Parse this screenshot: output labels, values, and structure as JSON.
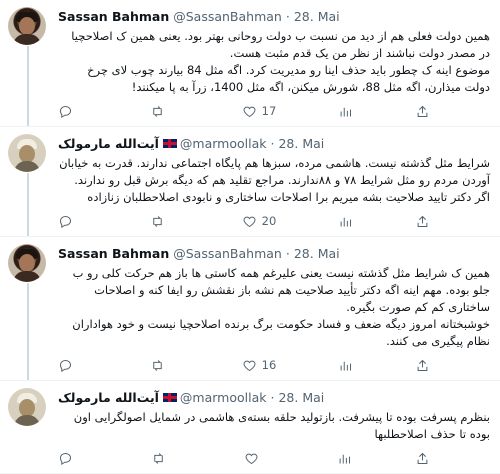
{
  "tweets": [
    {
      "author": "Sassan Bahman",
      "handle": "@SassanBahman",
      "dot": "·",
      "date": "28. Mai",
      "flag": false,
      "avatar": "sassan",
      "lines": [
        "همین دولت فعلی هم از دید من نسبت ب دولت روحانی بهتر بود. یعنی همین ک اصلاحچیا در مصدر دولت نباشند از نظر من یک قدم مثبت هست.",
        "موضوع اینه ک چطور باید حذف  اینا رو مدیریت کرد. اگه مثل 84 بیارند چوب لای چرخ دولت میذارن، اگه مثل 88، شورش میکنن، اگه مثل 1400، زرآ به پا میکنند!"
      ],
      "replies": "",
      "retweets": "",
      "likes": "17"
    },
    {
      "author": "آیت‌الله مارمولک",
      "handle": "@marmoollak",
      "dot": "·",
      "date": "28. Mai",
      "flag": true,
      "avatar": "marmo",
      "lines": [
        "شرایط مثل گذشته نیست. هاشمی مرده، سبزها هم پایگاه اجتماعی ندارند. قدرت به خیابان آوردن مردم رو مثل شرایط ۷۸ و ۸۸ندارند. مراجع تقلید هم که دیگه برش قبل رو ندارند.",
        "اگر دکتر تایید صلاحیت بشه میریم برا اصلاحات ساختاری و نابودی اصلاحطلبان زنازاده"
      ],
      "replies": "",
      "retweets": "",
      "likes": "20"
    },
    {
      "author": "Sassan Bahman",
      "handle": "@SassanBahman",
      "dot": "·",
      "date": "28. Mai",
      "flag": false,
      "avatar": "sassan",
      "lines": [
        "همین ک شرایط مثل گذشته نیست یعنی علیرغم همه کاستی ها باز هم حرکت کلی رو ب جلو بوده. مهم اینه اگه دکتر تأیید صلاحیت هم نشه باز نقشش رو ایفا کنه و اصلاحات ساختاری کم کم صورت بگیره.",
        "خوشبختانه امروز دیگه ضعف و فساد حکومت برگ برنده اصلاحچیا نیست و خود هواداران نظام پیگیری می کنند."
      ],
      "replies": "",
      "retweets": "",
      "likes": "16"
    },
    {
      "author": "آیت‌الله مارمولک",
      "handle": "@marmoollak",
      "dot": "·",
      "date": "28. Mai",
      "flag": true,
      "avatar": "marmo",
      "lines": [
        "بنظرم پسرفت بوده تا پیشرفت. بازتولید حلقه بسته‌ی هاشمی در شمایل اصولگرایی اون بوده تا حذف اصلاحطلبها"
      ],
      "replies": "",
      "retweets": "",
      "likes": ""
    }
  ],
  "icons": {
    "reply": "reply-icon",
    "retweet": "retweet-icon",
    "like": "heart-icon",
    "views": "views-icon",
    "share": "share-icon"
  },
  "colors": {
    "text": "#0f1419",
    "muted": "#536471",
    "divider": "#eff3f4",
    "thread": "#cfd9de"
  }
}
